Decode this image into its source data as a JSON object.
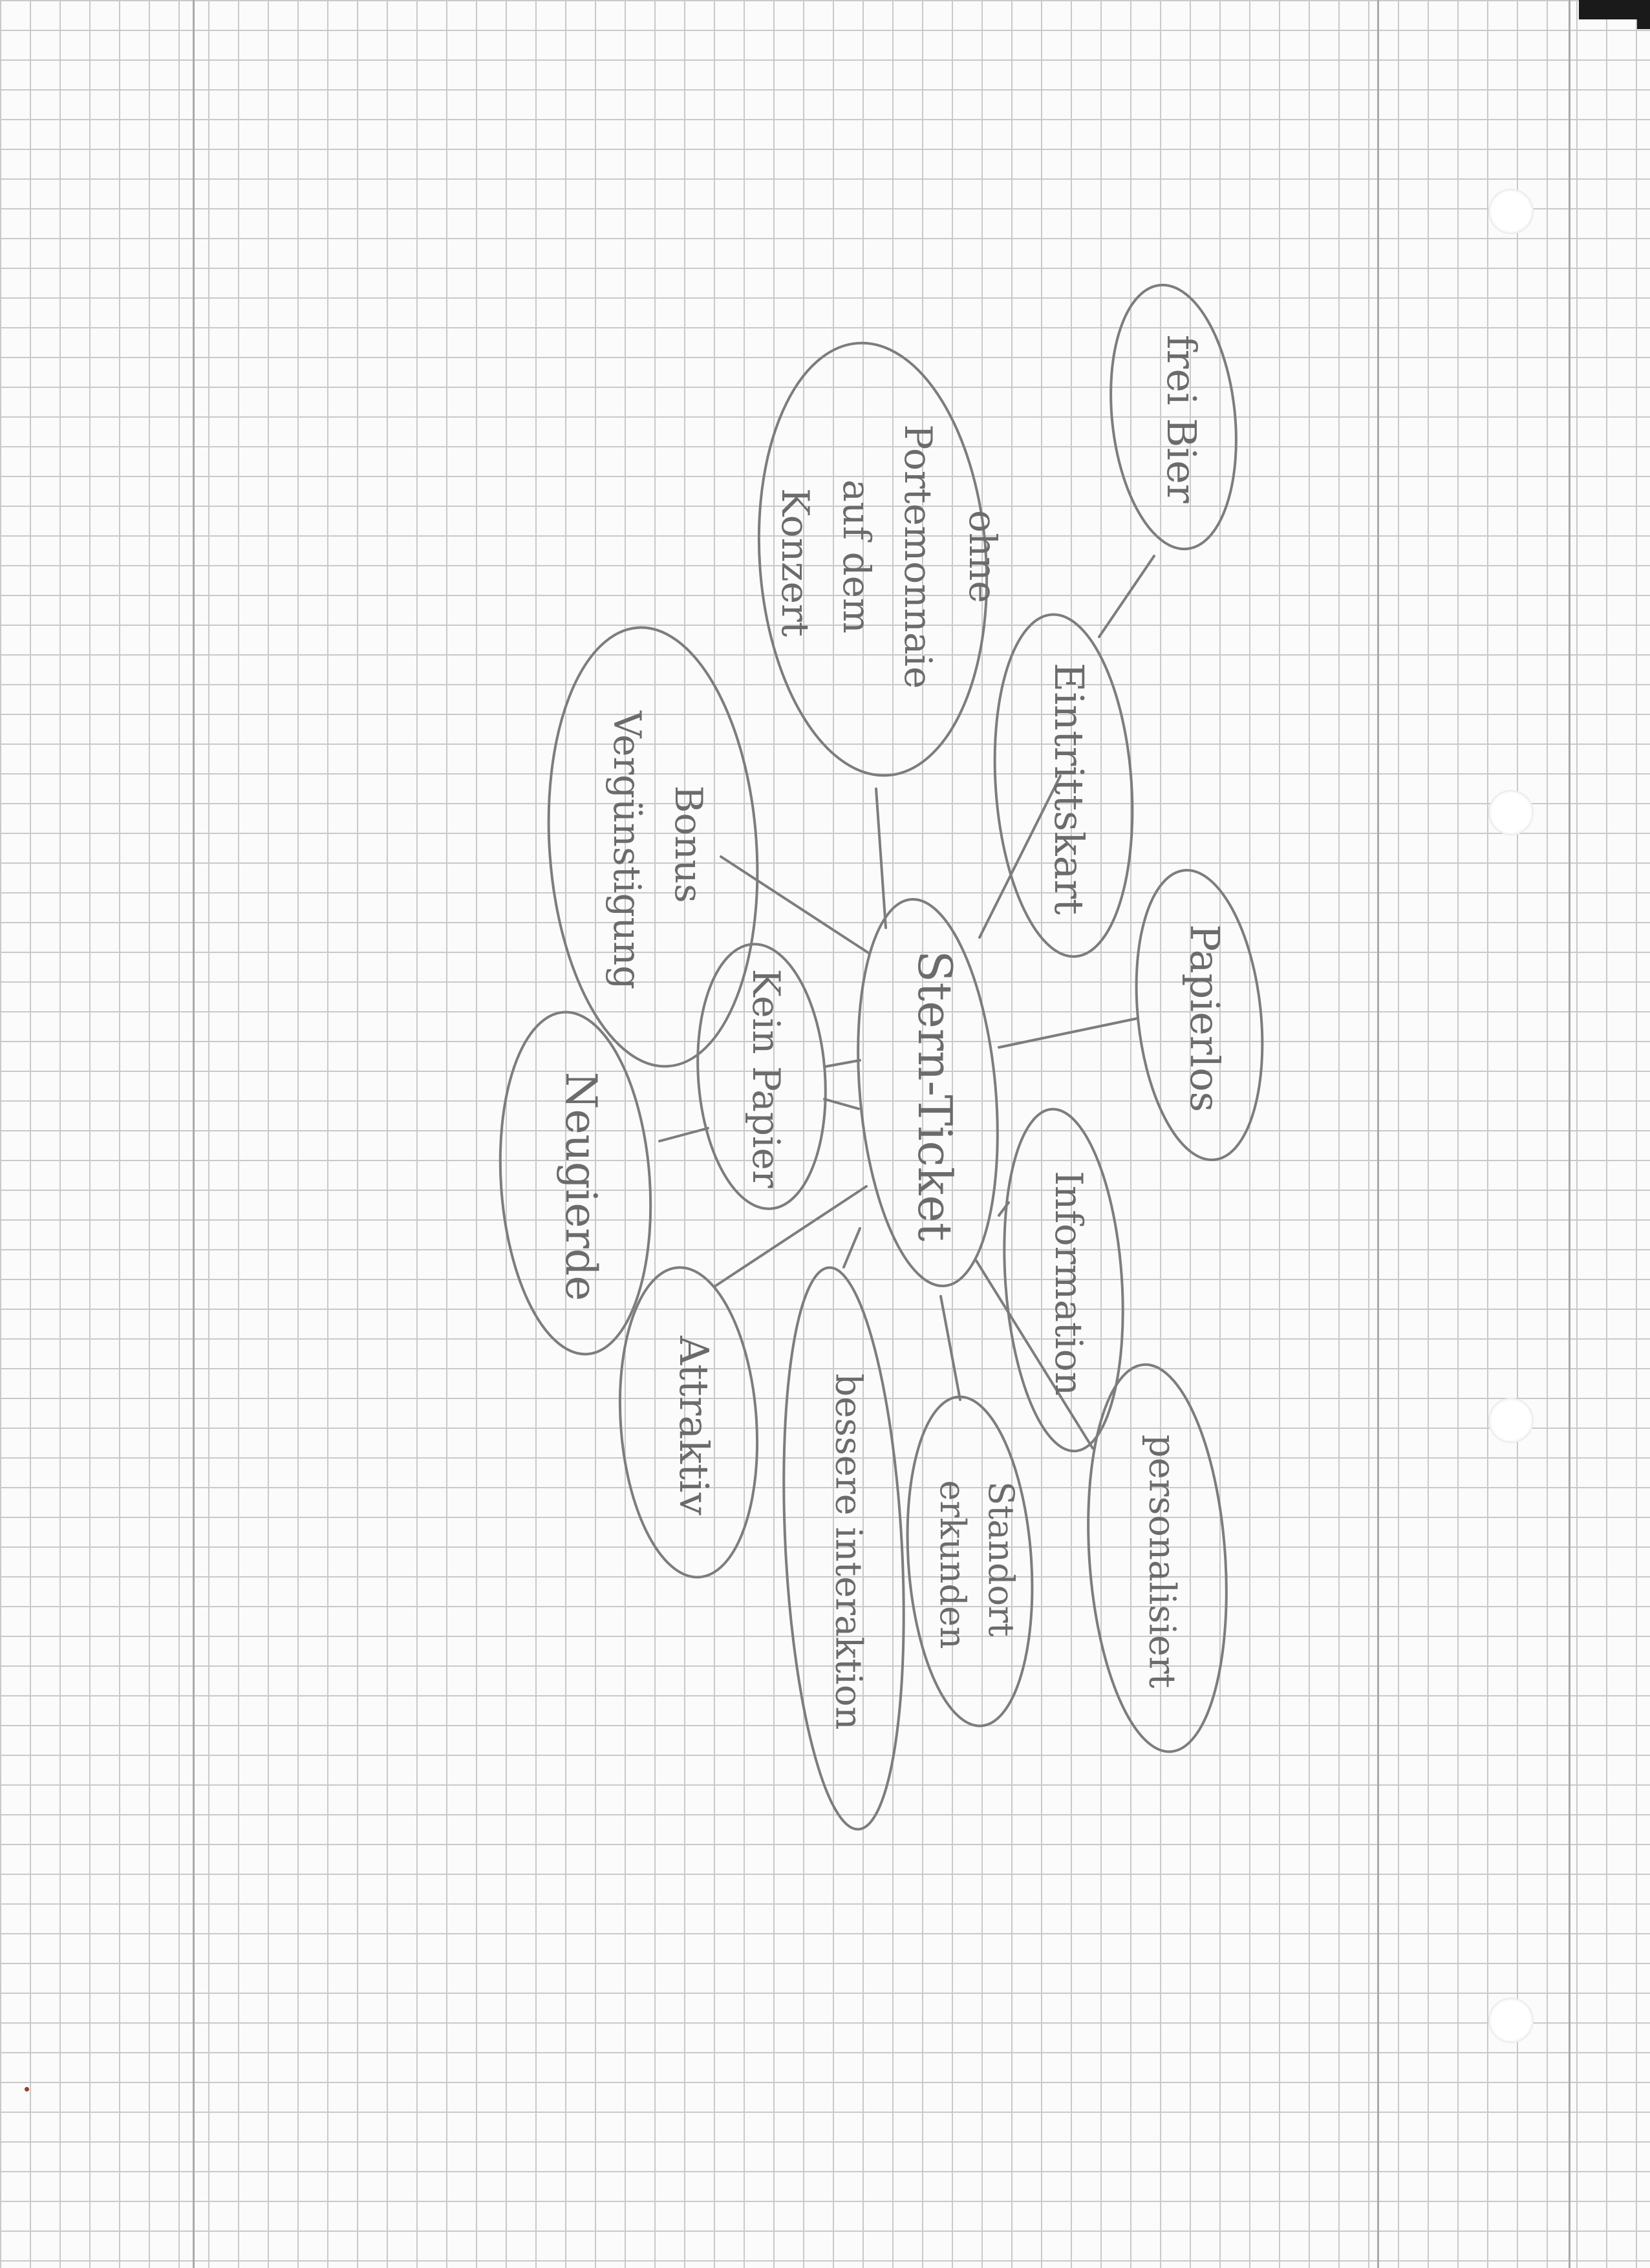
{
  "diagram": {
    "center": {
      "label": "Stern-Ticket"
    },
    "nodes": [
      {
        "id": "frei-bier",
        "label": "frei Bier",
        "parent": "eintrittskarte"
      },
      {
        "id": "eintrittskarte",
        "label": "Eintrittskart",
        "parent": "center"
      },
      {
        "id": "ohne-portemonnaie",
        "lines": [
          "ohne",
          "Portemonnaie",
          "auf dem",
          "Konzert"
        ],
        "parent": "center"
      },
      {
        "id": "bonus",
        "lines": [
          "Bonus",
          "Vergünstigung"
        ],
        "parent": "center"
      },
      {
        "id": "kein-papier",
        "label": "Kein Papier",
        "parent": "center"
      },
      {
        "id": "neugierde",
        "label": "Neugierde",
        "parent": "kein-papier"
      },
      {
        "id": "papierlos",
        "label": "Papierlos",
        "parent": "center"
      },
      {
        "id": "information",
        "label": "Information",
        "parent": "center"
      },
      {
        "id": "attraktiv",
        "label": "Attraktiv",
        "parent": "center"
      },
      {
        "id": "bessere-interaktion",
        "label": "bessere interaktion",
        "parent": "center"
      },
      {
        "id": "standort",
        "lines": [
          "Standort",
          "erkunden"
        ],
        "parent": "center"
      },
      {
        "id": "personalisiert",
        "label": "personalisiert",
        "parent": "center"
      }
    ]
  }
}
